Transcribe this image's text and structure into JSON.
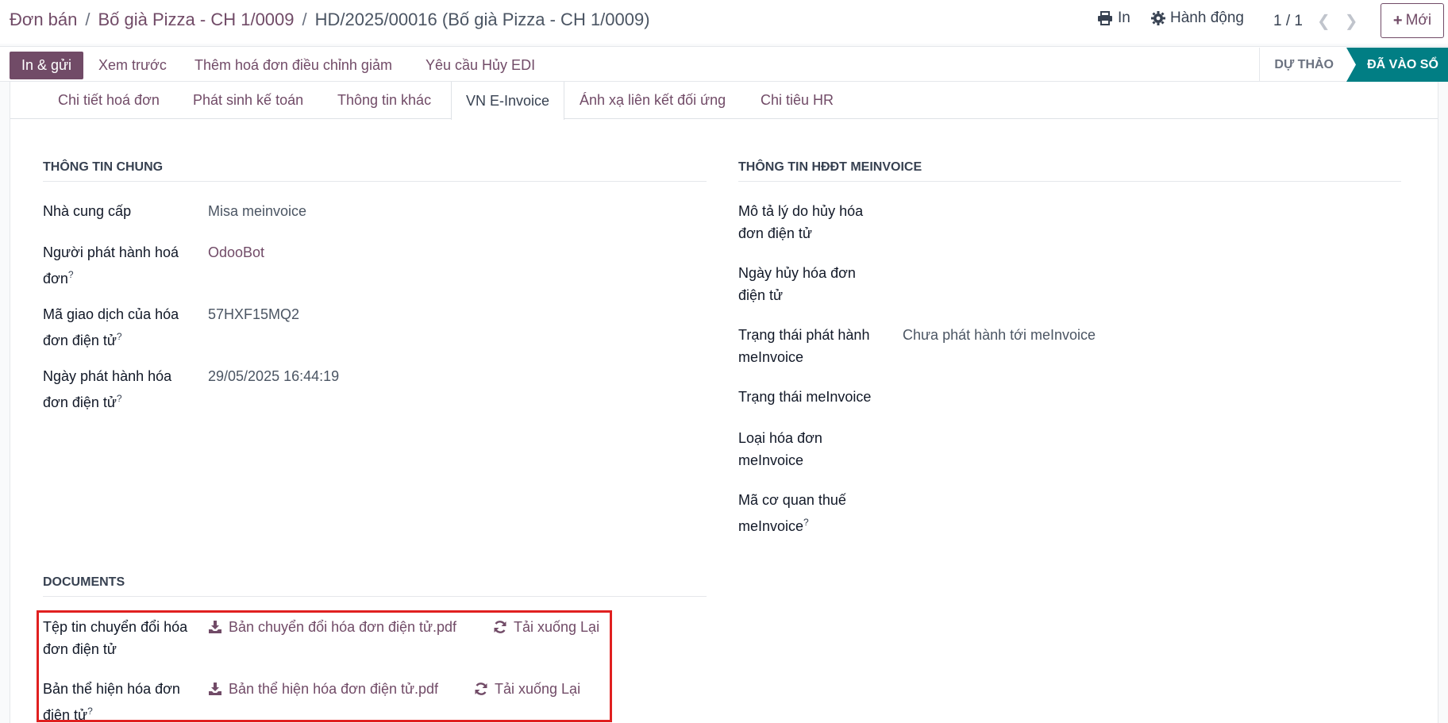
{
  "breadcrumb": {
    "root": "Đơn bán",
    "parent": "Bố già Pizza - CH 1/0009",
    "current": "HD/2025/00016 (Bố già Pizza - CH 1/0009)"
  },
  "topbar": {
    "print_label": "In",
    "action_label": "Hành động",
    "pager": "1 / 1",
    "new_label": "Mới"
  },
  "controlbar": {
    "buttons": [
      "In & gửi",
      "Xem trước",
      "Thêm hoá đơn điều chỉnh giảm",
      "Yêu cầu Hủy EDI"
    ],
    "status_draft": "DỰ THẢO",
    "status_posted": "ĐÃ VÀO SỔ"
  },
  "tabs": [
    "Chi tiết hoá đơn",
    "Phát sinh kế toán",
    "Thông tin khác",
    "VN E-Invoice",
    "Ánh xạ liên kết đối ứng",
    "Chi tiêu HR"
  ],
  "general": {
    "title": "THÔNG TIN CHUNG",
    "provider_label": "Nhà cung cấp",
    "provider_value": "Misa meinvoice",
    "issuer_label_1": "Người phát hành hoá",
    "issuer_label_2": "đơn",
    "issuer_value": "OdooBot",
    "txn_label_1": "Mã giao dịch của hóa",
    "txn_label_2": "đơn điện tử",
    "txn_value": "57HXF15MQ2",
    "date_label_1": "Ngày phát hành hóa",
    "date_label_2": "đơn điện tử",
    "date_value": "29/05/2025 16:44:19"
  },
  "meinvoice": {
    "title": "THÔNG TIN HĐĐT MEINVOICE",
    "cancel_reason_1": "Mô tả lý do hủy hóa",
    "cancel_reason_2": "đơn điện tử",
    "cancel_date_1": "Ngày hủy hóa đơn",
    "cancel_date_2": "điện tử",
    "issue_status_1": "Trạng thái phát hành",
    "issue_status_2": "meInvoice",
    "issue_status_value": "Chưa phát hành tới meInvoice",
    "status_label": "Trạng thái meInvoice",
    "type_1": "Loại hóa đơn",
    "type_2": "meInvoice",
    "tax_code_1": "Mã cơ quan thuế",
    "tax_code_2": "meInvoice"
  },
  "documents": {
    "title": "DOCUMENTS",
    "converted_label_1": "Tệp tin chuyển đổi hóa",
    "converted_label_2": "đơn điện tử",
    "converted_file": "Bản chuyển đổi hóa đơn điện tử.pdf",
    "representation_label_1": "Bản thể hiện hóa đơn",
    "representation_label_2": "điện tử",
    "representation_file": "Bản thể hiện hóa đơn điện tử.pdf",
    "reload_label": "Tải xuống Lại"
  },
  "help_mark": "?",
  "colors": {
    "brand": "#714B67",
    "posted": "#017e84",
    "highlight": "#e02020"
  }
}
